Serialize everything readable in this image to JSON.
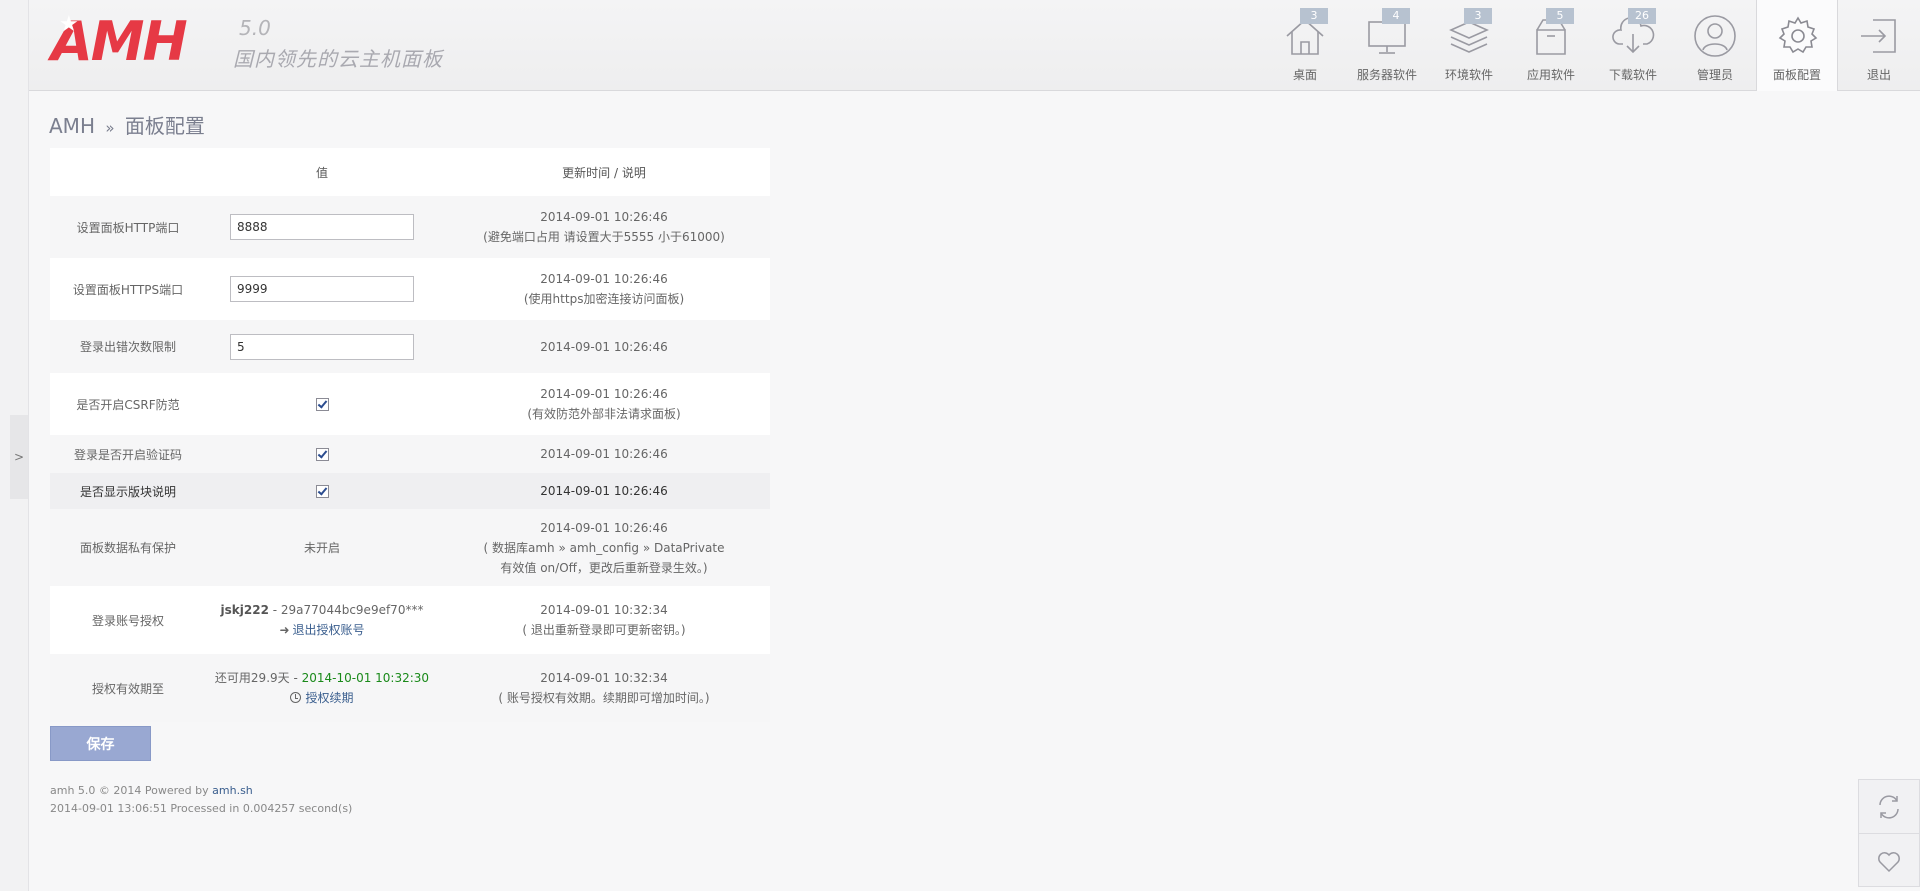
{
  "header": {
    "logo_text": "AMH",
    "version": "5.0",
    "slogan": "国内领先的云主机面板",
    "nav": [
      {
        "label": "桌面",
        "badge": "3",
        "icon": "home-icon"
      },
      {
        "label": "服务器软件",
        "badge": "4",
        "icon": "monitor-icon"
      },
      {
        "label": "环境软件",
        "badge": "3",
        "icon": "layers-icon"
      },
      {
        "label": "应用软件",
        "badge": "5",
        "icon": "box-icon"
      },
      {
        "label": "下载软件",
        "badge": "26",
        "icon": "cloud-download-icon"
      },
      {
        "label": "管理员",
        "badge": "",
        "icon": "user-icon"
      },
      {
        "label": "面板配置",
        "badge": "",
        "icon": "gear-icon"
      },
      {
        "label": "退出",
        "badge": "",
        "icon": "logout-icon"
      }
    ]
  },
  "left_toggle": ">",
  "breadcrumb": {
    "root": "AMH",
    "sep": "»",
    "current": "面板配置"
  },
  "table": {
    "header_value": "值",
    "header_desc": "更新时间 / 说明",
    "rows": {
      "http_port": {
        "label": "设置面板HTTP端口",
        "value": "8888",
        "time": "2014-09-01 10:26:46",
        "note": "(避免端口占用 请设置大于5555 小于61000)"
      },
      "https_port": {
        "label": "设置面板HTTPS端口",
        "value": "9999",
        "time": "2014-09-01 10:26:46",
        "note": "(使用https加密连接访问面板)"
      },
      "login_limit": {
        "label": "登录出错次数限制",
        "value": "5",
        "time": "2014-09-01 10:26:46"
      },
      "csrf": {
        "label": "是否开启CSRF防范",
        "time": "2014-09-01 10:26:46",
        "note": "(有效防范外部非法请求面板)"
      },
      "captcha": {
        "label": "登录是否开启验证码",
        "time": "2014-09-01 10:26:46"
      },
      "module_desc": {
        "label": "是否显示版块说明",
        "time": "2014-09-01 10:26:46"
      },
      "privacy": {
        "label": "面板数据私有保护",
        "value": "未开启",
        "time": "2014-09-01 10:26:46",
        "note1": "( 数据库amh » amh_config » DataPrivate",
        "note2": "有效值 on/Off，更改后重新登录生效。)"
      },
      "account": {
        "label": "登录账号授权",
        "user": "jskj222",
        "key": " - 29a77044bc9e9ef70***",
        "action": "退出授权账号",
        "time": "2014-09-01 10:32:34",
        "note": "( 退出重新登录即可更新密钥。)"
      },
      "expiry": {
        "label": "授权有效期至",
        "remain": "还可用29.9天 - ",
        "date": "2014-10-01 10:32:30",
        "action": "授权续期",
        "time": "2014-09-01 10:32:34",
        "note": "( 账号授权有效期。续期即可增加时间。)"
      }
    }
  },
  "save_label": "保存",
  "footer": {
    "line1_prefix": "amh 5.0 © 2014 Powered by ",
    "line1_link": "amh.sh",
    "line2": "2014-09-01 13:06:51 Processed in 0.004257 second(s)"
  }
}
